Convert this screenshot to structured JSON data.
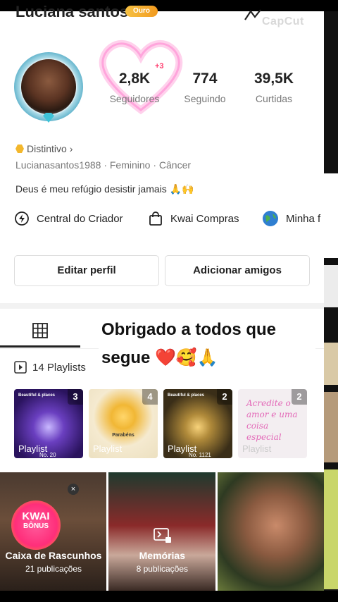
{
  "profile": {
    "name": "Luciana santos",
    "level_badge": "Ouro",
    "watermark": "CapCut",
    "stats": [
      {
        "value": "2,8K",
        "label": "Seguidores"
      },
      {
        "value": "774",
        "label": "Seguindo"
      },
      {
        "value": "39,5K",
        "label": "Curtidas"
      }
    ],
    "new_followers": "+3",
    "distintivo": "Distintivo",
    "distintivo_arrow": "›",
    "meta": "Lucianasantos1988 · Feminino · Câncer",
    "bio": "Deus é meu refúgio desistir jamais 🙏🙌"
  },
  "shortcuts": [
    {
      "label": "Central do Criador",
      "icon": "lightning-icon"
    },
    {
      "label": "Kwai Compras",
      "icon": "shopping-bag-icon"
    },
    {
      "label": "Minha f",
      "icon": "globe-icon"
    }
  ],
  "buttons": {
    "edit": "Editar perfil",
    "add_friends": "Adicionar amigos"
  },
  "overlay_text": "Obrigado a todos que segue ❤️🥰🙏",
  "playlists": {
    "header": "14 Playlists",
    "cards": [
      {
        "count": "3",
        "caption": "Playlist",
        "sub": "No. 20",
        "title": "Beautiful & places",
        "bg": "#3b1f7a"
      },
      {
        "count": "4",
        "caption": "Playlist",
        "mid": "Parabéns",
        "bg": "#f3e6c4"
      },
      {
        "count": "2",
        "caption": "Playlist",
        "sub": "No. 1121",
        "title": "Beautiful & places",
        "bg": "#2d2414"
      },
      {
        "count": "2",
        "caption": "Playlist",
        "cursive": "Acredite o amor e uma coisa especial",
        "bg": "#f4eff2"
      }
    ]
  },
  "posts": [
    {
      "title": "Caixa de Rascunhos",
      "sub": "21 publicações",
      "badge": "KWAI",
      "badge_sub": "BÔNUS",
      "close": "×"
    },
    {
      "title": "Memórias",
      "sub": "8 publicações"
    },
    {
      "title": "",
      "sub": ""
    }
  ]
}
